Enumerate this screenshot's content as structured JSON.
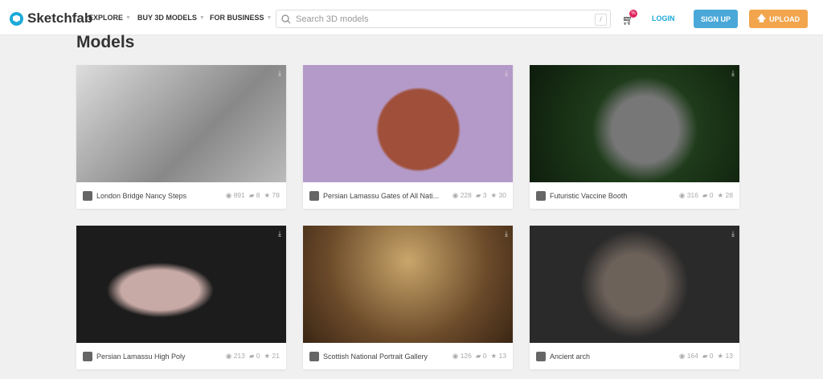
{
  "header": {
    "brand": "Sketchfab",
    "nav": [
      "EXPLORE",
      "BUY 3D MODELS",
      "FOR BUSINESS"
    ],
    "search_placeholder": "Search 3D models",
    "search_shortcut": "/",
    "cart_badge": "%",
    "login": "LOGIN",
    "signup": "SIGN UP",
    "upload": "UPLOAD"
  },
  "page_title": "Models",
  "models": [
    {
      "name": "London Bridge Nancy Steps",
      "views": "891",
      "comments": "8",
      "likes": "78",
      "thumb": "linear-gradient(135deg,#ddd,#888 60%,#bbb)"
    },
    {
      "name": "Persian Lamassu Gates of All Nati...",
      "views": "228",
      "comments": "3",
      "likes": "30",
      "thumb": "radial-gradient(circle at 55% 55%,#a0503a 0 30%,#b49ac8 32%)"
    },
    {
      "name": "Futuristic Vaccine Booth",
      "views": "316",
      "comments": "0",
      "likes": "28",
      "thumb": "radial-gradient(circle at 55% 55%,#777 0 25%,#1e3b1a 40%,#0e1c0c)"
    },
    {
      "name": "Persian Lamassu High Poly",
      "views": "213",
      "comments": "0",
      "likes": "21",
      "thumb": "radial-gradient(ellipse at 40% 55%,#c7a9a5 0 22%,#1c1c1c 30%)"
    },
    {
      "name": "Scottish National Portrait Gallery",
      "views": "126",
      "comments": "0",
      "likes": "13",
      "thumb": "radial-gradient(circle at 50% 30%,#c9a66a,#6b4a2a 60%,#3a2614)"
    },
    {
      "name": "Ancient arch",
      "views": "164",
      "comments": "0",
      "likes": "13",
      "thumb": "radial-gradient(circle at 50% 50%,#6d625a 0 25%,#2a2a2a 45%)"
    }
  ],
  "icons": {
    "views": "eye-icon",
    "comments": "comment-icon",
    "likes": "star-icon",
    "download": "download-icon"
  }
}
